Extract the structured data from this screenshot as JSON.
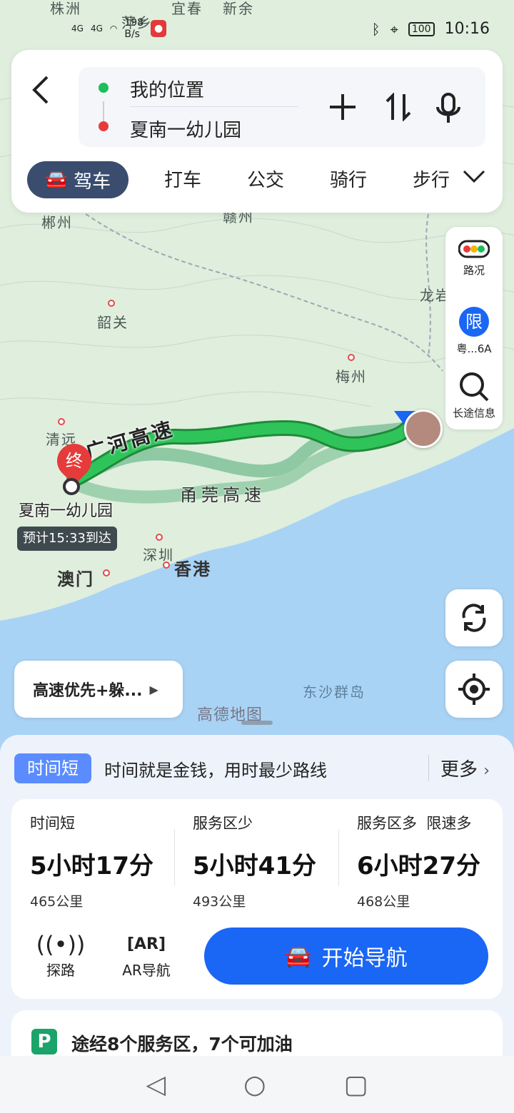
{
  "status_bar": {
    "signal1": "4G",
    "signal2": "4G",
    "speed": "198\nB/s",
    "battery": "100",
    "time": "10:16"
  },
  "route_input": {
    "origin": "我的位置",
    "destination": "夏南一幼儿园"
  },
  "modes": [
    "驾车",
    "打车",
    "公交",
    "骑行",
    "步行"
  ],
  "side_buttons": {
    "traffic": "路况",
    "restriction_badge": "限",
    "restriction": "粤...6A",
    "long_trip": "长途信息"
  },
  "map": {
    "places": {
      "chenzhou": "郴州",
      "ganzhou": "赣州",
      "shaoguan": "韶关",
      "meizhou": "梅州",
      "longyan": "龙岩",
      "qingyuan": "清远",
      "shenzhen": "深圳",
      "hongkong": "香港",
      "macau": "澳门",
      "dongsha": "东沙群岛",
      "yichun": "宜春",
      "pingxiang": "萍乡",
      "zhuzhou": "株洲",
      "xinyu": "新余"
    },
    "road1": "广河高速",
    "road2": "甬莞高速",
    "dest_pin": "终",
    "dest_label": "夏南一幼儿园",
    "eta": "预计15:33到达",
    "preference": "高速优先+躲...",
    "logo": "高德地图"
  },
  "panel": {
    "tag": "时间短",
    "tagline": "时间就是金钱，用时最少路线",
    "more": "更多",
    "routes": [
      {
        "label": "时间短",
        "duration": "5小时17分",
        "distance": "465公里"
      },
      {
        "label": "服务区少",
        "duration": "5小时41分",
        "distance": "493公里"
      },
      {
        "label": "服务区多  限速多",
        "duration": "6小时27分",
        "distance": "468公里"
      }
    ],
    "tool1": "探路",
    "tool2": "AR导航",
    "start": "开始导航",
    "services_icon": "P",
    "services": "途经8个服务区，7个可加油"
  },
  "colors": {
    "accent": "#1a66f5",
    "route": "#22b24c",
    "tag": "#5b8cff"
  }
}
